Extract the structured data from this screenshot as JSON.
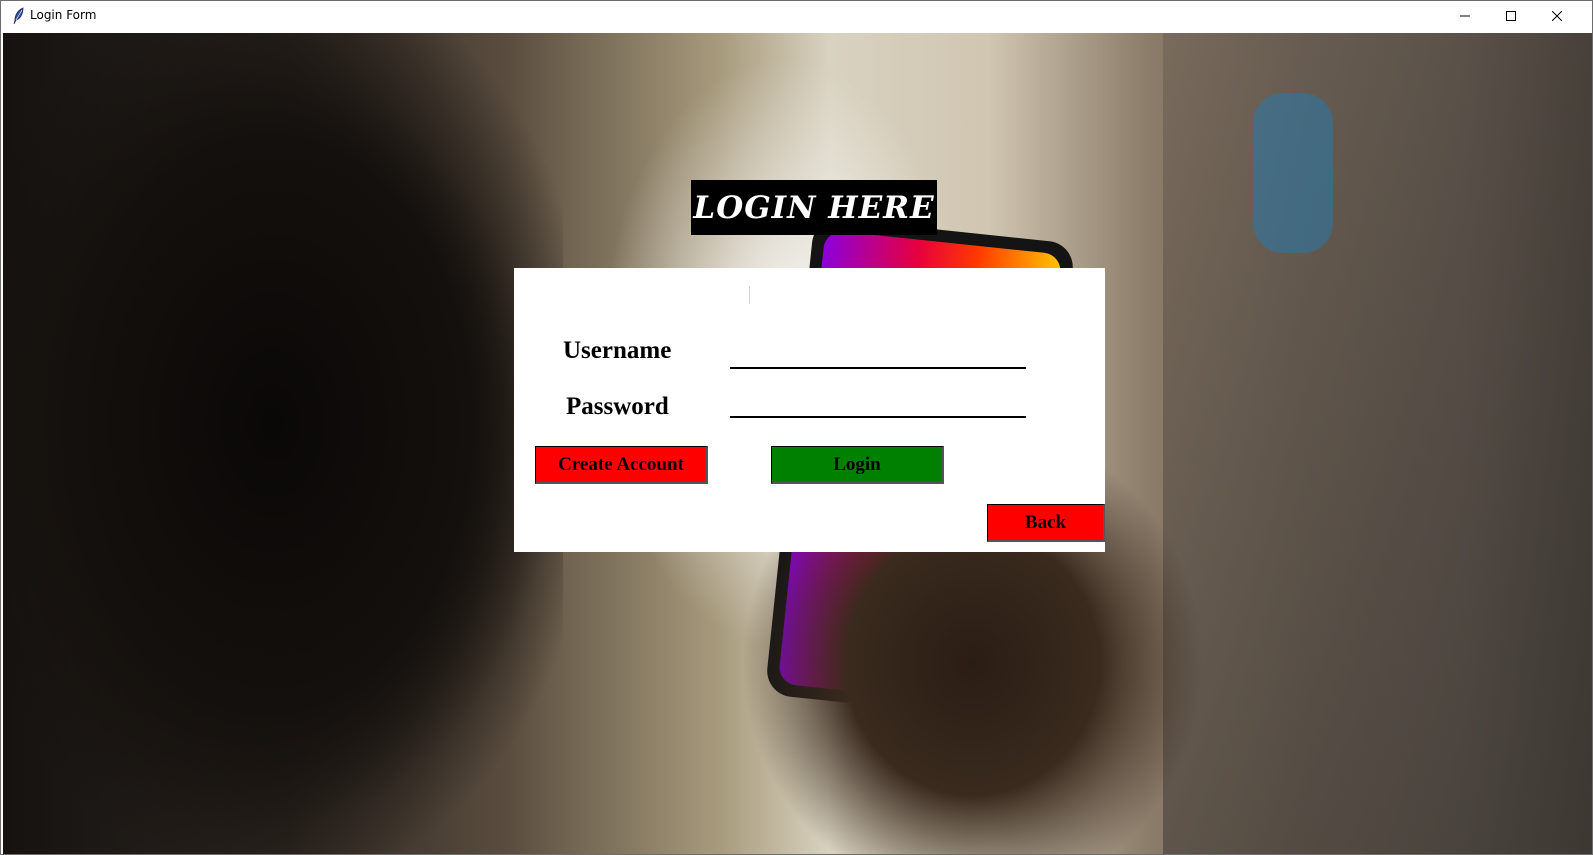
{
  "window": {
    "title": "Login Form",
    "controls": {
      "minimize": "minimize",
      "maximize": "maximize",
      "close": "close"
    }
  },
  "heading": "LOGIN HERE",
  "form": {
    "username_label": "Username",
    "username_value": "",
    "password_label": "Password",
    "password_value": ""
  },
  "buttons": {
    "create_account": "Create Account",
    "login": "Login",
    "back": "Back"
  },
  "colors": {
    "create_account_bg": "#ff0000",
    "login_bg": "#008000",
    "back_bg": "#ff0000",
    "heading_bg": "#000000",
    "heading_text": "#ffffff"
  },
  "icons": {
    "app": "feather-icon",
    "minimize": "minimize-icon",
    "maximize": "maximize-icon",
    "close": "close-icon"
  }
}
